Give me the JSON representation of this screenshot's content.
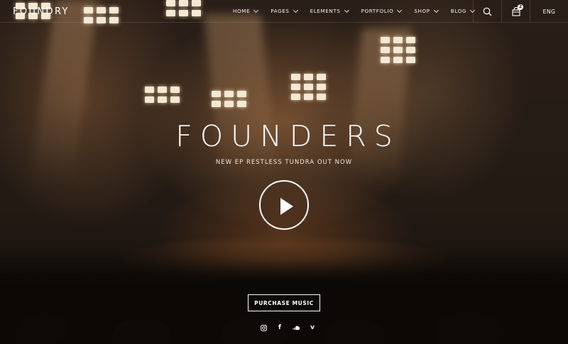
{
  "brand": {
    "logo": "FOUNDRY"
  },
  "nav": {
    "items": [
      {
        "label": "HOME"
      },
      {
        "label": "PAGES"
      },
      {
        "label": "ELEMENTS"
      },
      {
        "label": "PORTFOLIO"
      },
      {
        "label": "SHOP"
      },
      {
        "label": "BLOG"
      }
    ],
    "cart_count": "2",
    "language": "ENG"
  },
  "hero": {
    "title": "FOUNDERS",
    "subtitle": "NEW EP RESTLESS TUNDRA OUT NOW",
    "cta_label": "PURCHASE MUSIC"
  },
  "social": [
    {
      "icon": "instagram-icon"
    },
    {
      "icon": "facebook-icon",
      "glyph": "f"
    },
    {
      "icon": "soundcloud-icon"
    },
    {
      "icon": "vimeo-icon",
      "glyph": "v"
    }
  ],
  "colors": {
    "text": "#ffffff",
    "background": "#1a1512",
    "warm_light": "#b47846"
  }
}
